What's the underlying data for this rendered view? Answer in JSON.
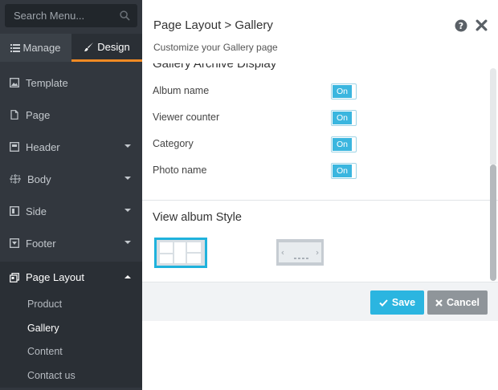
{
  "sidebar": {
    "search": {
      "placeholder": "Search Menu..."
    },
    "tabs": {
      "manage": "Manage",
      "design": "Design"
    },
    "items": [
      {
        "label": "Template",
        "icon": "image-icon"
      },
      {
        "label": "Page",
        "icon": "page-icon"
      },
      {
        "label": "Header",
        "icon": "header-icon",
        "expandable": true
      },
      {
        "label": "Body",
        "icon": "body-icon",
        "expandable": true
      },
      {
        "label": "Side",
        "icon": "side-icon",
        "expandable": true
      },
      {
        "label": "Footer",
        "icon": "footer-icon",
        "expandable": true
      },
      {
        "label": "Page Layout",
        "icon": "page-layout-icon",
        "expandable": true,
        "active": true
      }
    ],
    "subitems": [
      {
        "label": "Product"
      },
      {
        "label": "Gallery",
        "active": true
      },
      {
        "label": "Content"
      },
      {
        "label": "Contact us"
      }
    ]
  },
  "panel": {
    "title": "Page Layout > Gallery",
    "subtitle": "Customize your Gallery page",
    "section_heading": "Gallery Archive Display",
    "settings": [
      {
        "label": "Album name",
        "state": "On"
      },
      {
        "label": "Viewer counter",
        "state": "On"
      },
      {
        "label": "Category",
        "state": "On"
      },
      {
        "label": "Photo name",
        "state": "On"
      }
    ],
    "view_style_title": "View album Style",
    "buttons": {
      "save": "Save",
      "cancel": "Cancel"
    }
  },
  "colors": {
    "sidebar_bg": "#32373e",
    "accent_orange": "#f08a24",
    "toggle_blue": "#3bb6df",
    "save_blue": "#2bb5e0",
    "cancel_gray": "#8f959a"
  }
}
